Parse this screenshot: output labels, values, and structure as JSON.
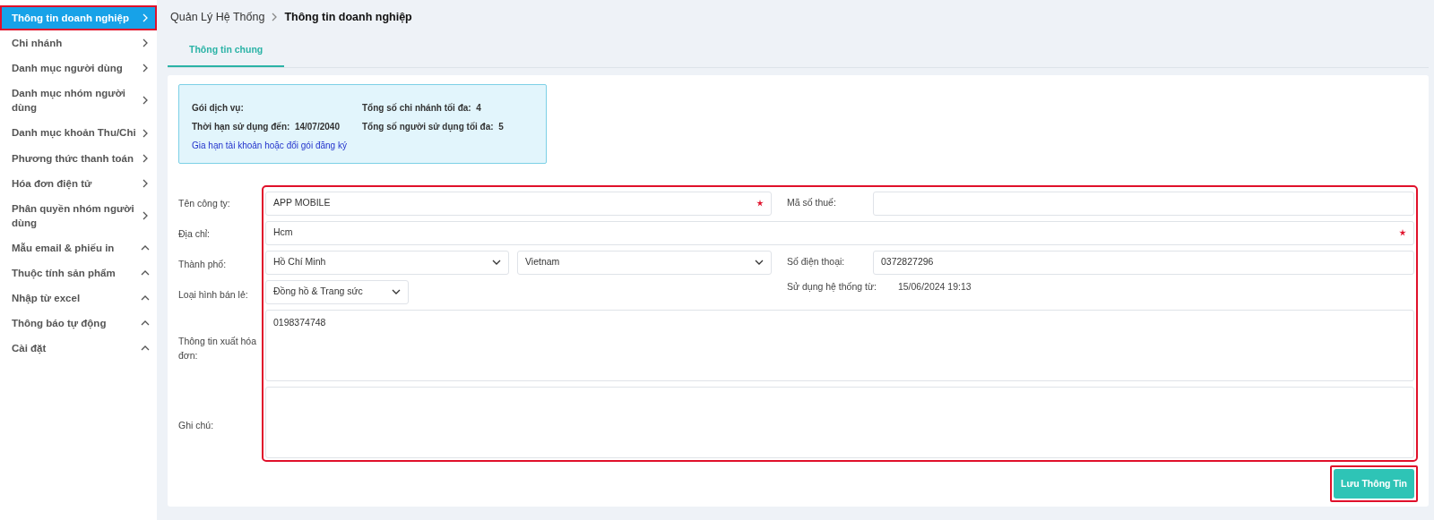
{
  "sidebar": {
    "items": [
      {
        "label": "Thông tin doanh nghiệp",
        "selected": true,
        "expanded": false,
        "highlighted": true
      },
      {
        "label": "Chi nhánh",
        "selected": false,
        "expanded": false,
        "highlighted": false
      },
      {
        "label": "Danh mục người dùng",
        "selected": false,
        "expanded": false,
        "highlighted": false
      },
      {
        "label": "Danh mục nhóm người dùng",
        "selected": false,
        "expanded": false,
        "highlighted": false
      },
      {
        "label": "Danh mục khoản Thu/Chi",
        "selected": false,
        "expanded": false,
        "highlighted": false
      },
      {
        "label": "Phương thức thanh toán",
        "selected": false,
        "expanded": false,
        "highlighted": false
      },
      {
        "label": "Hóa đơn điện tử",
        "selected": false,
        "expanded": false,
        "highlighted": false
      },
      {
        "label": "Phân quyền nhóm người dùng",
        "selected": false,
        "expanded": false,
        "highlighted": false
      },
      {
        "label": "Mẫu email & phiếu in",
        "selected": false,
        "expanded": true,
        "highlighted": false
      },
      {
        "label": "Thuộc tính sản phẩm",
        "selected": false,
        "expanded": true,
        "highlighted": false
      },
      {
        "label": "Nhập từ excel",
        "selected": false,
        "expanded": true,
        "highlighted": false
      },
      {
        "label": "Thông báo tự động",
        "selected": false,
        "expanded": true,
        "highlighted": false
      },
      {
        "label": "Cài đặt",
        "selected": false,
        "expanded": true,
        "highlighted": false
      }
    ]
  },
  "breadcrumb": {
    "parent": "Quản Lý Hệ Thống",
    "current": "Thông tin doanh nghiệp"
  },
  "tabs": [
    {
      "label": "Thông tin chung",
      "selected": true
    }
  ],
  "service_info": {
    "items": [
      {
        "label": "Gói dịch vụ:"
      },
      {
        "label": "Tổng số chi nhánh tối đa:",
        "value": "4"
      },
      {
        "label": "Thời hạn sử dụng đến:",
        "value": "14/07/2040"
      },
      {
        "label": "Tổng số người sử dụng tối đa:",
        "value": "5"
      }
    ],
    "link": "Gia hạn tài khoản hoặc đổi gói đăng ký"
  },
  "form": {
    "highlighted": true,
    "company_name": {
      "label": "Tên công ty:",
      "value": "APP MOBILE",
      "required": true
    },
    "tax_code": {
      "label": "Mã số thuế:"
    },
    "address": {
      "label": "Địa chỉ:",
      "value": "Hcm",
      "required": true
    },
    "city": {
      "label": "Thành phố:",
      "value": "Hồ Chí Minh"
    },
    "country": {
      "value": "Vietnam"
    },
    "phone": {
      "label": "Số điện thoại:",
      "value": "0372827296"
    },
    "retail_type": {
      "label": "Loại hình bán lẻ:",
      "value": "Đồng hồ & Trang sức"
    },
    "usage_since": {
      "label": "Sử dụng hệ thống từ:",
      "value": "15/06/2024 19:13"
    },
    "invoice_info": {
      "label": "Thông tin xuất hóa đơn:",
      "value": "0198374748"
    },
    "note": {
      "label": "Ghi chú:"
    }
  },
  "save_button": {
    "label": "Lưu Thông Tin",
    "highlighted": true
  }
}
